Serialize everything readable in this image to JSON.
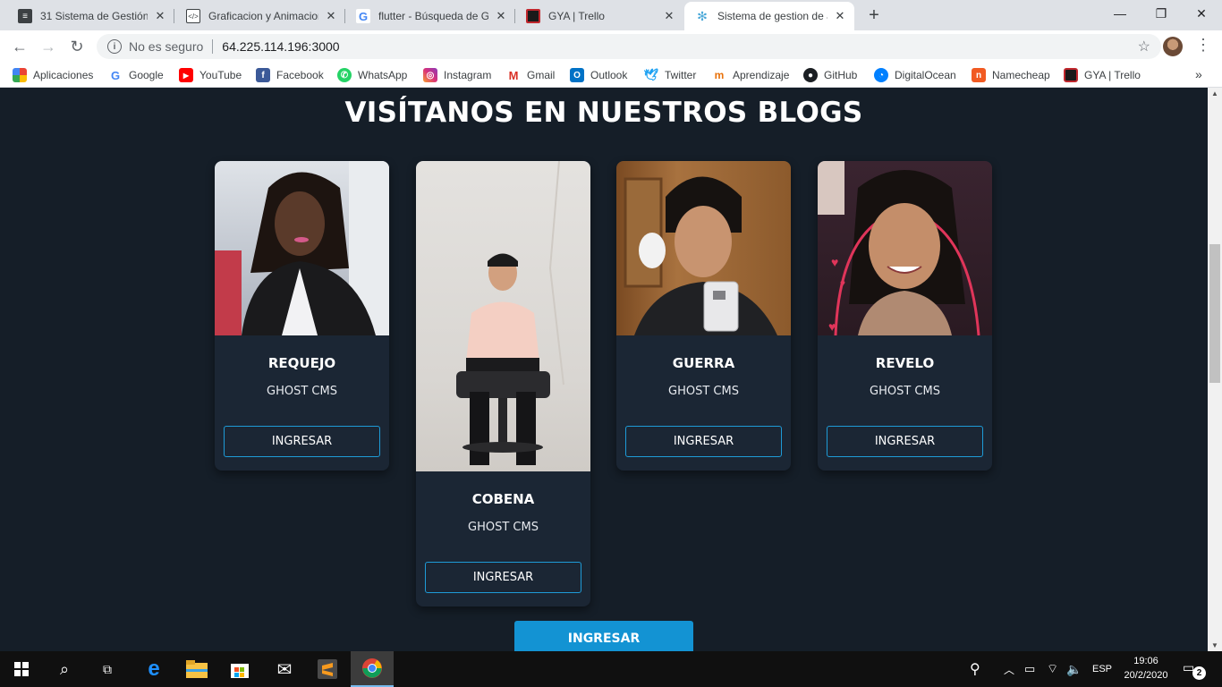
{
  "browser": {
    "tabs": [
      {
        "title": "31 Sistema de Gestión d",
        "favicon": "doc-icon",
        "active": false
      },
      {
        "title": "Graficacion y Animacion",
        "favicon": "code-icon",
        "active": false
      },
      {
        "title": "flutter - Búsqueda de G",
        "favicon": "google-icon",
        "active": false
      },
      {
        "title": "GYA | Trello",
        "favicon": "trello-icon",
        "active": false
      },
      {
        "title": "Sistema de gestion de a",
        "favicon": "gear-icon",
        "active": true
      }
    ],
    "new_tab_symbol": "+",
    "address": {
      "security_text": "No es seguro",
      "url": "64.225.114.196:3000"
    },
    "bookmarks": [
      "Aplicaciones",
      "Google",
      "YouTube",
      "Facebook",
      "WhatsApp",
      "Instagram",
      "Gmail",
      "Outlook",
      "Twitter",
      "Aprendizaje",
      "GitHub",
      "DigitalOcean",
      "Namecheap",
      "GYA | Trello"
    ],
    "bookmarks_overflow": "»"
  },
  "page": {
    "title": "VISÍTANOS EN NUESTROS BLOGS",
    "cards": [
      {
        "name": "REQUEJO",
        "platform": "GHOST CMS",
        "button": "INGRESAR"
      },
      {
        "name": "COBENA",
        "platform": "GHOST CMS",
        "button": "INGRESAR"
      },
      {
        "name": "GUERRA",
        "platform": "GHOST CMS",
        "button": "INGRESAR"
      },
      {
        "name": "REVELO",
        "platform": "GHOST CMS",
        "button": "INGRESAR"
      }
    ],
    "main_button": "INGRESAR"
  },
  "taskbar": {
    "language": "ESP",
    "time": "19:06",
    "date": "20/2/2020",
    "notification_count": "2"
  },
  "colors": {
    "page_bg": "#151e28",
    "card_bg": "#1b2634",
    "accent": "#1e9bd7",
    "main_button": "#1393d3"
  }
}
